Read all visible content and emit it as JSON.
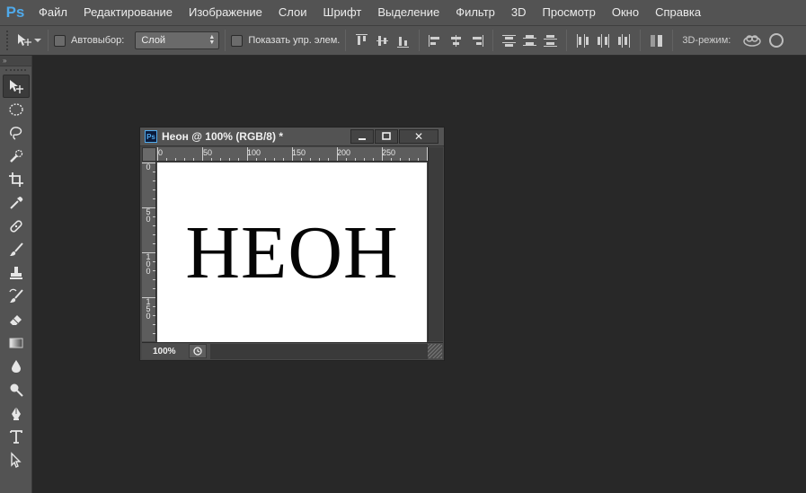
{
  "app": {
    "logo": "Ps"
  },
  "menu": [
    "Файл",
    "Редактирование",
    "Изображение",
    "Слои",
    "Шрифт",
    "Выделение",
    "Фильтр",
    "3D",
    "Просмотр",
    "Окно",
    "Справка"
  ],
  "options": {
    "auto_select_label": "Автовыбор:",
    "auto_select_value": "Слой",
    "show_transform_label": "Показать упр. элем.",
    "mode_3d_label": "3D-режим:"
  },
  "toolbar": {
    "header": "»",
    "tools": [
      "move-tool",
      "marquee-tool",
      "lasso-tool",
      "quick-select-tool",
      "crop-tool",
      "eyedropper-tool",
      "healing-brush-tool",
      "brush-tool",
      "clone-stamp-tool",
      "history-brush-tool",
      "eraser-tool",
      "gradient-tool",
      "blur-tool",
      "dodge-tool",
      "pen-tool",
      "type-tool",
      "path-select-tool"
    ]
  },
  "document": {
    "title": "Неон @ 100% (RGB/8) *",
    "ps_badge": "Ps",
    "minimize_icon": "minimize-icon",
    "maximize_icon": "maximize-icon",
    "close_label": "✕",
    "ruler_h": [
      "0",
      "50",
      "100",
      "150",
      "200",
      "250"
    ],
    "ruler_v": [
      "0",
      "5\n0",
      "1\n0\n0",
      "1\n5\n0"
    ],
    "canvas_text": "НЕОН",
    "zoom": "100%"
  },
  "colors": {
    "accent": "#4fa9ea",
    "chrome": "#535353",
    "workspace": "#282828"
  }
}
